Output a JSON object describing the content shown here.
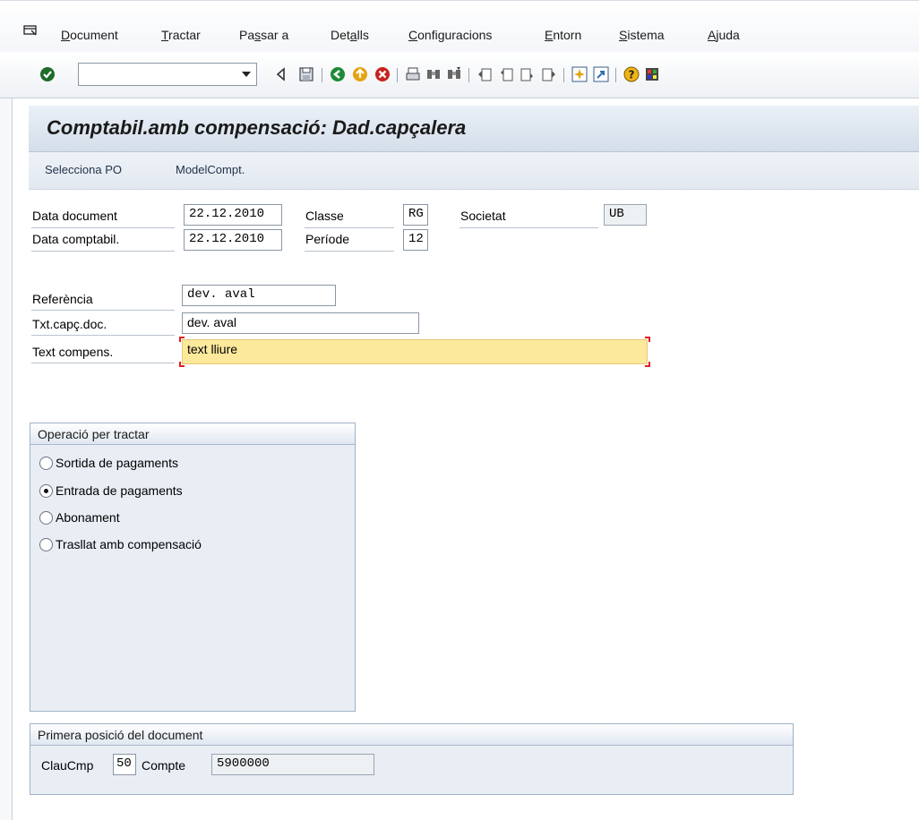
{
  "menu": {
    "items": [
      {
        "pre": "",
        "u": "D",
        "post": "ocument"
      },
      {
        "pre": "",
        "u": "T",
        "post": "ractar"
      },
      {
        "pre": "Pa",
        "u": "s",
        "post": "sar a"
      },
      {
        "pre": "Det",
        "u": "a",
        "post": "lls"
      },
      {
        "pre": "",
        "u": "C",
        "post": "onfiguracions"
      },
      {
        "pre": "",
        "u": "E",
        "post": "ntorn"
      },
      {
        "pre": "",
        "u": "S",
        "post": "istema"
      },
      {
        "pre": "",
        "u": "A",
        "post": "juda"
      }
    ]
  },
  "toolbar": {
    "command_value": "",
    "icons": [
      "enter-icon",
      "back-nav-icon",
      "save-icon",
      "back-icon",
      "exit-icon",
      "cancel-icon",
      "print-icon",
      "find-icon",
      "find-next-icon",
      "first-page-icon",
      "previous-page-icon",
      "next-page-icon",
      "last-page-icon",
      "create-session-icon",
      "shortcut-icon",
      "help-icon",
      "layout-icon"
    ]
  },
  "title": "Comptabil.amb compensació: Dad.capçalera",
  "app_toolbar": {
    "select_po": "Selecciona PO",
    "model": "ModelCompt."
  },
  "header": {
    "doc_date_label": "Data document",
    "doc_date": "22.12.2010",
    "post_date_label": "Data comptabil.",
    "post_date": "22.12.2010",
    "class_label": "Classe",
    "class_value": "RG",
    "period_label": "Període",
    "period_value": "12",
    "company_label": "Societat",
    "company_value": "UB",
    "reference_label": "Referència",
    "reference_value": "dev. aval",
    "header_text_label": "Txt.capç.doc.",
    "header_text_value": "dev. aval",
    "clearing_text_label": "Text compens.",
    "clearing_text_value": "text lliure"
  },
  "operation": {
    "title": "Operació per tractar",
    "options": [
      {
        "label": "Sortida de pagaments",
        "selected": false
      },
      {
        "label": "Entrada de pagaments",
        "selected": true
      },
      {
        "label": "Abonament",
        "selected": false
      },
      {
        "label": "Trasllat amb compensació",
        "selected": false
      }
    ]
  },
  "first_item": {
    "title": "Primera posició del document",
    "posting_key_label": "ClauCmp",
    "posting_key_value": "50",
    "account_label": "Compte",
    "account_value": "5900000"
  }
}
